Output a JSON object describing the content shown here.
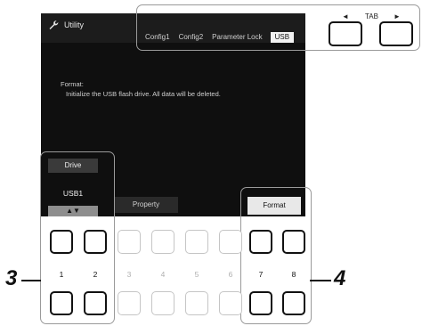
{
  "header": {
    "title": "Utility",
    "tabs": [
      "Config1",
      "Config2",
      "Parameter Lock",
      "USB"
    ],
    "active_tab_index": 3,
    "tab_nav_label": "TAB",
    "tab_left_arrow": "◄",
    "tab_right_arrow": "►"
  },
  "message": {
    "line1": "Format:",
    "line2": "Initialize the USB flash drive. All data will be deleted."
  },
  "drive": {
    "label": "Drive",
    "value": "USB1",
    "arrows": "▲▼"
  },
  "buttons": {
    "property_label": "Property",
    "format_label": "Format"
  },
  "numbers": [
    "1",
    "2",
    "3",
    "4",
    "5",
    "6",
    "7",
    "8"
  ],
  "callouts": {
    "left": "3",
    "right": "4"
  }
}
